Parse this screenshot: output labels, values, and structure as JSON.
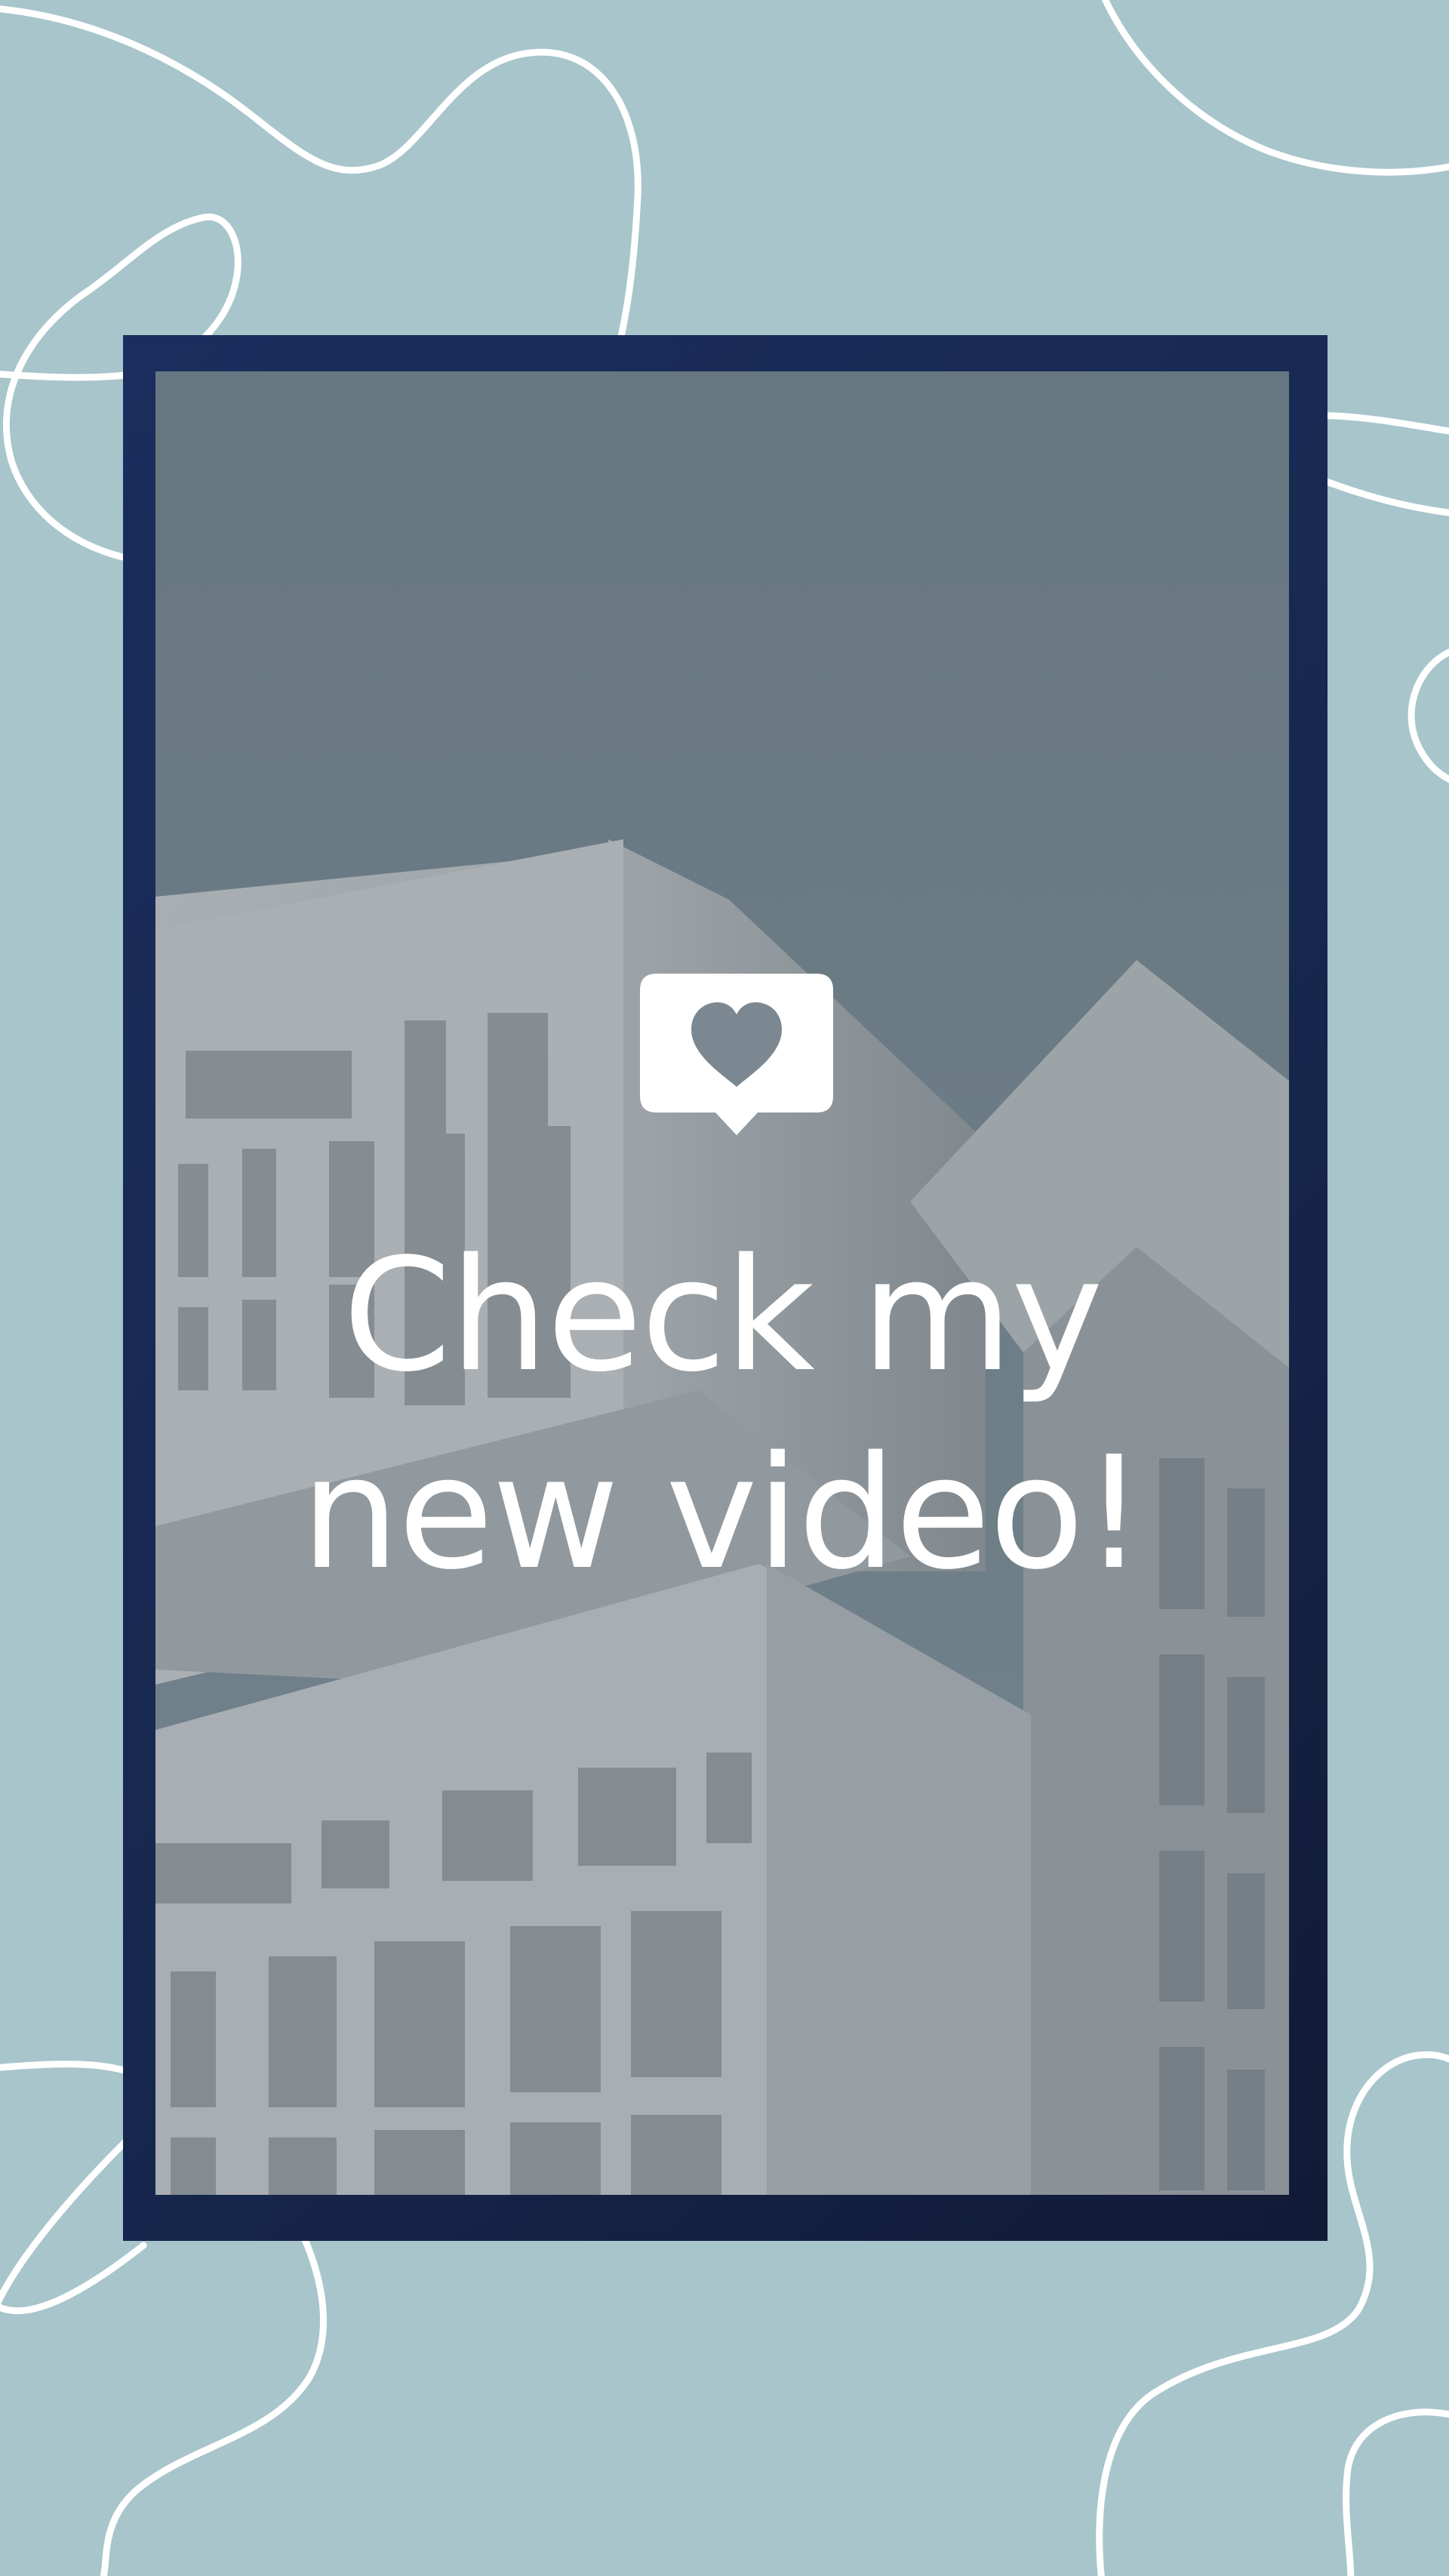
{
  "headline": {
    "line1": "Check my",
    "line2": "new video!"
  },
  "icons": {
    "main": "heart-speech-bubble-icon"
  },
  "colors": {
    "background": "#a7c5cb",
    "frame": "#1b2d5e",
    "doodle_stroke": "#ffffff",
    "text": "#ffffff",
    "photo_overlay": "#708089"
  }
}
